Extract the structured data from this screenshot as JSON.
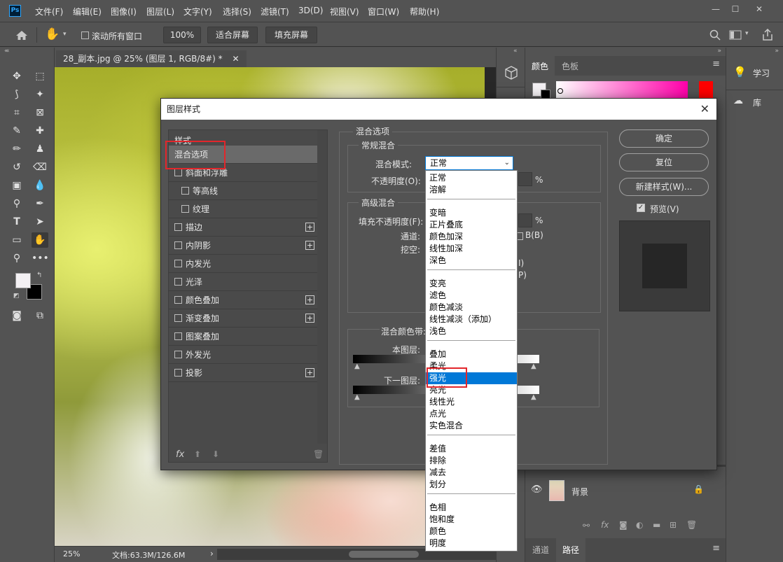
{
  "menubar": {
    "logo": "Ps",
    "items": [
      "文件(F)",
      "编辑(E)",
      "图像(I)",
      "图层(L)",
      "文字(Y)",
      "选择(S)",
      "滤镜(T)",
      "3D(D)",
      "视图(V)",
      "窗口(W)",
      "帮助(H)"
    ],
    "minimize": "—",
    "maximize": "☐",
    "close": "✕"
  },
  "options": {
    "scroll_all": "滚动所有窗口",
    "zoom": "100%",
    "fit_screen": "适合屏幕",
    "fill_screen": "填充屏幕"
  },
  "document": {
    "tab_title": "28_副本.jpg @ 25% (图层 1, RGB/8#) *",
    "tab_close": "✕",
    "zoom": "25%",
    "doc_info": "文档:63.3M/126.6M",
    "arrow": "›"
  },
  "panels": {
    "color_tab": "颜色",
    "swatches_tab": "色板",
    "learn": "学习",
    "libraries": "库",
    "channels_tab": "通道",
    "paths_tab": "路径",
    "background_layer": "背景",
    "accent_red": "#ff0000"
  },
  "dialog": {
    "title": "图层样式",
    "close": "✕",
    "styles_header": "样式",
    "styles": [
      {
        "label": "混合选项",
        "checkbox": false,
        "plus": false,
        "indent": 0
      },
      {
        "label": "斜面和浮雕",
        "checkbox": true,
        "plus": false,
        "indent": 0
      },
      {
        "label": "等高线",
        "checkbox": true,
        "plus": false,
        "indent": 1
      },
      {
        "label": "纹理",
        "checkbox": true,
        "plus": false,
        "indent": 1
      },
      {
        "label": "描边",
        "checkbox": true,
        "plus": true,
        "indent": 0
      },
      {
        "label": "内阴影",
        "checkbox": true,
        "plus": true,
        "indent": 0
      },
      {
        "label": "内发光",
        "checkbox": true,
        "plus": false,
        "indent": 0
      },
      {
        "label": "光泽",
        "checkbox": true,
        "plus": false,
        "indent": 0
      },
      {
        "label": "颜色叠加",
        "checkbox": true,
        "plus": true,
        "indent": 0
      },
      {
        "label": "渐变叠加",
        "checkbox": true,
        "plus": true,
        "indent": 0
      },
      {
        "label": "图案叠加",
        "checkbox": true,
        "plus": false,
        "indent": 0
      },
      {
        "label": "外发光",
        "checkbox": true,
        "plus": false,
        "indent": 0
      },
      {
        "label": "投影",
        "checkbox": true,
        "plus": true,
        "indent": 0
      }
    ],
    "fx_label": "fx",
    "blend_options": "混合选项",
    "general_blend": "常规混合",
    "blend_mode_label": "混合模式:",
    "blend_mode_value": "正常",
    "opacity_label": "不透明度(O):",
    "percent": "%",
    "advanced_blend": "高级混合",
    "fill_opacity_label": "填充不透明度(F):",
    "channels_label": "通道:",
    "channel_b": "B(B)",
    "knockout_label": "挖空:",
    "partial_i": "I)",
    "partial_p": "P)",
    "blend_if_label": "混合颜色带:",
    "this_layer": "本图层:",
    "underlying_layer": "下一图层:",
    "ok": "确定",
    "reset": "复位",
    "new_style": "新建样式(W)...",
    "preview": "预览(V)"
  },
  "dropdown": {
    "groups": [
      [
        "正常",
        "溶解"
      ],
      [
        "变暗",
        "正片叠底",
        "颜色加深",
        "线性加深",
        "深色"
      ],
      [
        "变亮",
        "滤色",
        "颜色减淡",
        "线性减淡（添加）",
        "浅色"
      ],
      [
        "叠加",
        "柔光",
        "强光",
        "亮光",
        "线性光",
        "点光",
        "实色混合"
      ],
      [
        "差值",
        "排除",
        "减去",
        "划分"
      ],
      [
        "色相",
        "饱和度",
        "颜色",
        "明度"
      ]
    ],
    "selected": "强光"
  }
}
